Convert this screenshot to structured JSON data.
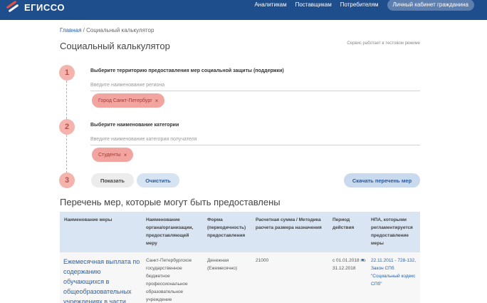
{
  "header": {
    "logo_text": "ЕГИССО",
    "nav": [
      "Аналитикам",
      "Поставщикам",
      "Потребителям",
      "Личный кабинет гражданина"
    ]
  },
  "breadcrumb": {
    "home": "Главная",
    "separator": " / ",
    "current": "Социальный калькулятор"
  },
  "page_title": "Социальный калькулятор",
  "test_note": "Сервис работает в тестовом режиме",
  "steps": [
    {
      "num": "1",
      "title": "Выберите территорию предоставления мер социальной защиты (поддержки)",
      "placeholder": "Введите наименование региона",
      "chip": "Город Санкт-Петербург"
    },
    {
      "num": "2",
      "title": "Выберите наименование категории",
      "placeholder": "Введите наименование категории получателя",
      "chip": "Студенты"
    },
    {
      "num": "3"
    }
  ],
  "chip_close": "×",
  "buttons": {
    "show": "Показать",
    "clear": "Очистить",
    "download": "Скачать перечень мер"
  },
  "results": {
    "title": "Перечень мер, которые могут быть предоставлены",
    "columns": [
      "Наименование меры",
      "Наименование органа/организации, предоставляющей меру",
      "Форма (периодичность) предоставления",
      "Расчетная сумма / Методика расчета размера назначения",
      "Период действия",
      "НПА, которыми регламентируется предоставление меры"
    ],
    "row": {
      "name": "Ежемесячная выплата по содержанию обучающихся в общеобразовательных учреждениях в части",
      "org": "Санкт-Петербургское государственное бюджетное профессиональное образовательное учреждение",
      "form": "Денежная (Ежемесячно)",
      "sum": "21000",
      "period": "с 01.01.2018 по 31.12.2018",
      "npa": "22.11.2011 - 728-132, Закон СПб \"Социальный кодекс СПб\""
    }
  }
}
